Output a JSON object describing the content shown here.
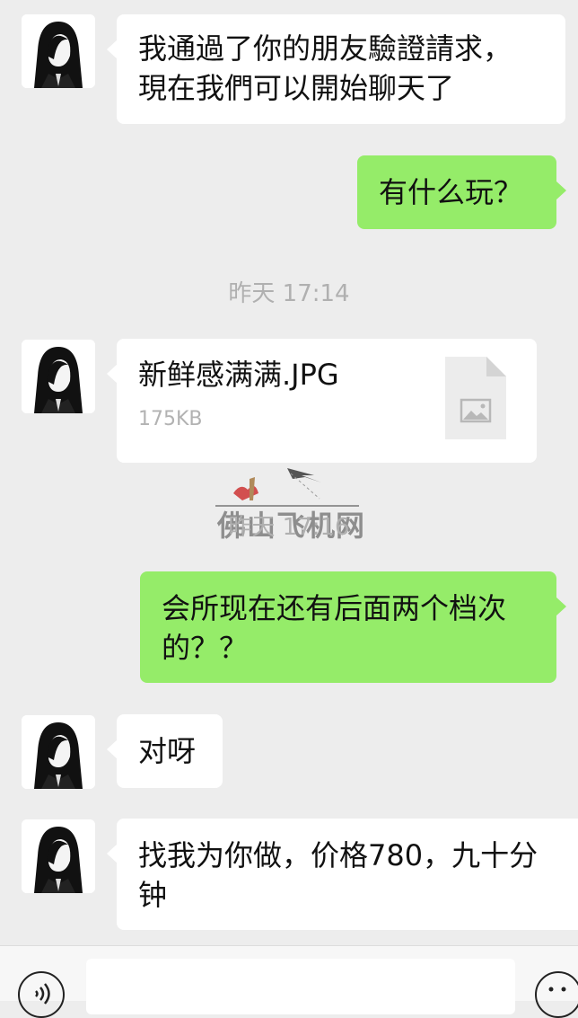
{
  "messages": [
    {
      "side": "in",
      "text": "我通過了你的朋友驗證請求，\n現在我們可以開始聊天了"
    },
    {
      "side": "out",
      "text": "有什么玩？"
    },
    {
      "side": "in",
      "file": {
        "name": "新鲜感满满.JPG",
        "size": "175KB",
        "icon": "image-file-icon"
      }
    },
    {
      "side": "out",
      "text": "会所现在还有后面两个档次\n的？？"
    },
    {
      "side": "in",
      "text": "对呀"
    },
    {
      "side": "in",
      "text": "找我为你做，价格780，九十分\n钟"
    }
  ],
  "timestamps": [
    "昨天 17:14",
    "昨天 17:16"
  ],
  "watermark": {
    "text": "佛山飞机网"
  },
  "input_bar": {
    "voice_icon": "voice-icon",
    "emoji_icon": "emoji-icon",
    "value": ""
  },
  "colors": {
    "background": "#ededed",
    "outgoing_bubble": "#95ec69",
    "incoming_bubble": "#ffffff"
  }
}
